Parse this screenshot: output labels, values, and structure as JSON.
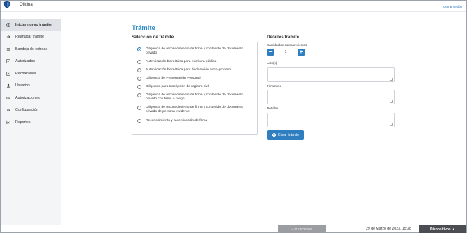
{
  "header": {
    "app_title": "Oficina",
    "logout_label": "Cerrar sesión"
  },
  "sidebar": {
    "items": [
      {
        "label": "Iniciar nuevo trámite",
        "icon": "plus-circle-icon",
        "active": true
      },
      {
        "label": "Reanudar trámite",
        "icon": "arrow-right-icon",
        "active": false
      },
      {
        "label": "Bandeja de entrada",
        "icon": "list-icon",
        "active": false
      },
      {
        "label": "Autorizados",
        "icon": "check-icon",
        "active": false
      },
      {
        "label": "Rechazados",
        "icon": "close-icon",
        "active": false
      },
      {
        "label": "Usuarios",
        "icon": "user-icon",
        "active": false
      },
      {
        "label": "Autorizaciones",
        "icon": "key-icon",
        "active": false
      },
      {
        "label": "Configuración",
        "icon": "gear-icon",
        "active": false
      },
      {
        "label": "Reportes",
        "icon": "chart-icon",
        "active": false
      }
    ]
  },
  "main": {
    "title": "Trámite",
    "selection_title": "Selección de trámite",
    "options": [
      {
        "label": "Diligencia de reconocimiento de firma y contenido de documento privado",
        "selected": true
      },
      {
        "label": "Autenticación biométrica para escritura pública",
        "selected": false
      },
      {
        "label": "Autenticación biométrica para declaración extra-proceso",
        "selected": false
      },
      {
        "label": "Diligencia de Presentación Personal",
        "selected": false
      },
      {
        "label": "Diligencia para Inscripción de registro civil",
        "selected": false
      },
      {
        "label": "Diligencia de reconocimiento de firma y contenido de documento privado con firma a ruego",
        "selected": false
      },
      {
        "label": "Diligencia de reconocimiento de firma y contenido de documento privado de persona invidente",
        "selected": false
      },
      {
        "label": "Reconocimiento y autenticación de firma",
        "selected": false
      }
    ],
    "details": {
      "title": "Detalles trámite",
      "count_label": "Cantidad de comparecientes",
      "count_value": "1",
      "minus_label": "−",
      "plus_label": "+",
      "acts_label": "Acto(s)",
      "signers_label": "Firmantes",
      "details_label": "Detalles",
      "acts_value": "",
      "signers_value": "",
      "details_value": "",
      "create_button": "Crear trámite"
    }
  },
  "footer": {
    "version": "v-1123032986",
    "datetime": "29 de Marzo de 2023, 15:38",
    "devices_label": "Dispositivos ▲"
  },
  "colors": {
    "accent": "#2f7fc0",
    "title": "#2f8bc9",
    "sidebar_bg": "#f4f5f6",
    "footer_dark": "#4a4d52"
  }
}
